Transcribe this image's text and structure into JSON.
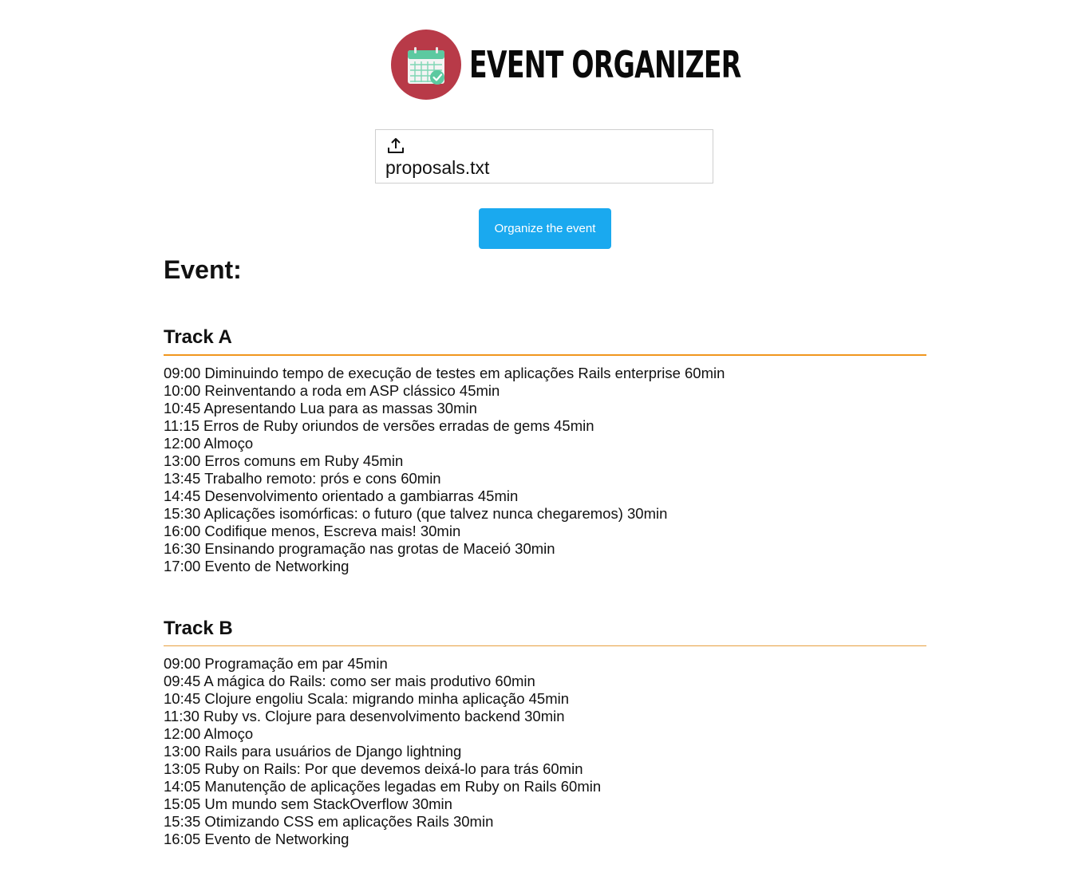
{
  "header": {
    "title": "EVENT ORGANIZER",
    "logo_icon": "calendar-check-icon",
    "logo_color": "#b83a48"
  },
  "upload": {
    "icon": "upload-icon",
    "file_name": "proposals.txt"
  },
  "actions": {
    "organize_label": "Organize the event",
    "organize_color": "#1aa9ef"
  },
  "event": {
    "heading": "Event:",
    "accent_color": "#f0961e",
    "tracks": [
      {
        "title": "Track A",
        "talks": [
          "09:00 Diminuindo tempo de execução de testes em aplicações Rails enterprise 60min",
          "10:00 Reinventando a roda em ASP clássico 45min",
          "10:45 Apresentando Lua para as massas 30min",
          "11:15 Erros de Ruby oriundos de versões erradas de gems 45min",
          "12:00 Almoço",
          "13:00 Erros comuns em Ruby 45min",
          "13:45 Trabalho remoto: prós e cons 60min",
          "14:45 Desenvolvimento orientado a gambiarras 45min",
          "15:30 Aplicações isomórficas: o futuro (que talvez nunca chegaremos) 30min",
          "16:00 Codifique menos, Escreva mais! 30min",
          "16:30 Ensinando programação nas grotas de Maceió 30min",
          "17:00 Evento de Networking"
        ]
      },
      {
        "title": "Track B",
        "talks": [
          "09:00 Programação em par 45min",
          "09:45 A mágica do Rails: como ser mais produtivo 60min",
          "10:45 Clojure engoliu Scala: migrando minha aplicação 45min",
          "11:30 Ruby vs. Clojure para desenvolvimento backend 30min",
          "12:00 Almoço",
          "13:00 Rails para usuários de Django lightning",
          "13:05 Ruby on Rails: Por que devemos deixá-lo para trás 60min",
          "14:05 Manutenção de aplicações legadas em Ruby on Rails 60min",
          "15:05 Um mundo sem StackOverflow 30min",
          "15:35 Otimizando CSS em aplicações Rails 30min",
          "16:05 Evento de Networking"
        ]
      }
    ]
  }
}
